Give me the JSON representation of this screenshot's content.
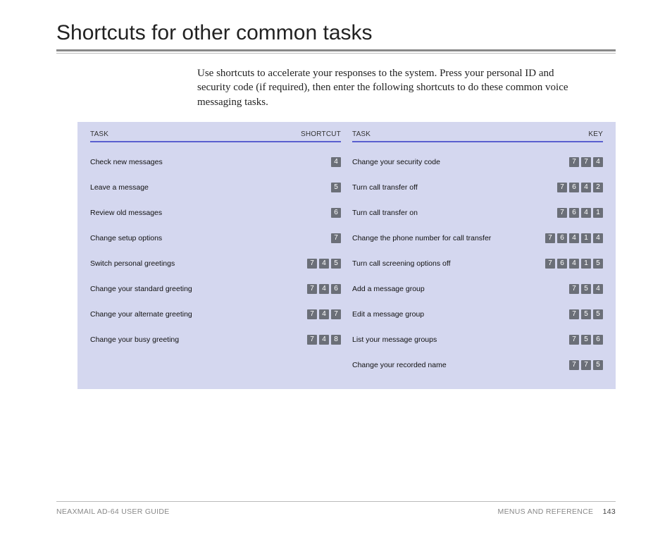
{
  "title": "Shortcuts for other common tasks",
  "intro": "Use shortcuts to accelerate your responses to the system. Press your personal ID and security code (if required), then enter the following shortcuts to do these common voice messaging tasks.",
  "left": {
    "h1": "TASK",
    "h2": "SHORTCUT",
    "rows": [
      {
        "task": "Check new messages",
        "keys": [
          "4"
        ]
      },
      {
        "task": "Leave a message",
        "keys": [
          "5"
        ]
      },
      {
        "task": "Review old messages",
        "keys": [
          "6"
        ]
      },
      {
        "task": "Change setup options",
        "keys": [
          "7"
        ]
      },
      {
        "task": "Switch personal greetings",
        "keys": [
          "7",
          "4",
          "5"
        ]
      },
      {
        "task": "Change your standard greeting",
        "keys": [
          "7",
          "4",
          "6"
        ]
      },
      {
        "task": "Change your alternate greeting",
        "keys": [
          "7",
          "4",
          "7"
        ]
      },
      {
        "task": "Change your busy greeting",
        "keys": [
          "7",
          "4",
          "8"
        ]
      }
    ]
  },
  "right": {
    "h1": "TASK",
    "h2": "KEY",
    "rows": [
      {
        "task": "Change your security code",
        "keys": [
          "7",
          "7",
          "4"
        ]
      },
      {
        "task": "Turn call transfer off",
        "keys": [
          "7",
          "6",
          "4",
          "2"
        ]
      },
      {
        "task": "Turn call transfer on",
        "keys": [
          "7",
          "6",
          "4",
          "1"
        ]
      },
      {
        "task": "Change the phone number for call transfer",
        "keys": [
          "7",
          "6",
          "4",
          "1",
          "4"
        ]
      },
      {
        "task": "Turn call screening options off",
        "keys": [
          "7",
          "6",
          "4",
          "1",
          "5"
        ]
      },
      {
        "task": "Add a message group",
        "keys": [
          "7",
          "5",
          "4"
        ]
      },
      {
        "task": "Edit a message group",
        "keys": [
          "7",
          "5",
          "5"
        ]
      },
      {
        "task": "List your message groups",
        "keys": [
          "7",
          "5",
          "6"
        ]
      },
      {
        "task": "Change your recorded name",
        "keys": [
          "7",
          "7",
          "5"
        ]
      }
    ]
  },
  "footer": {
    "left": "NEAXMAIL AD-64 USER GUIDE",
    "right": "MENUS AND REFERENCE",
    "page": "143"
  }
}
